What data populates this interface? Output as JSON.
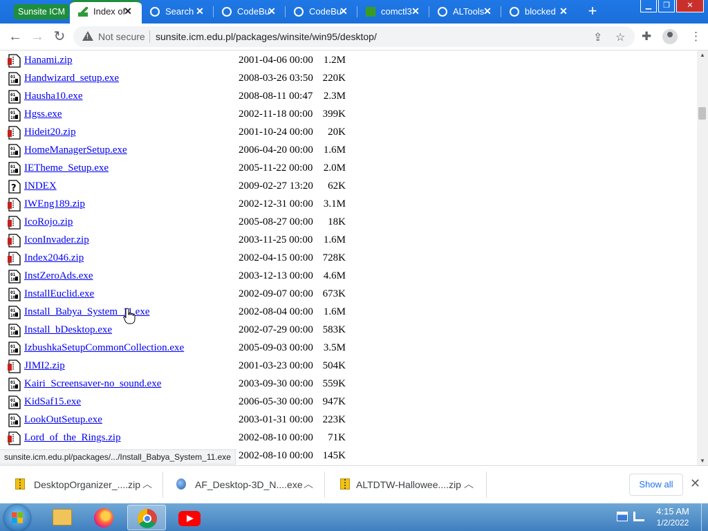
{
  "browser": {
    "tab_group_label": "Sunsite ICM",
    "tabs": [
      {
        "title": "Index of",
        "active": true
      },
      {
        "title": "Search"
      },
      {
        "title": "CodeBu"
      },
      {
        "title": "CodeBu"
      },
      {
        "title": "comctl3"
      },
      {
        "title": "ALTools"
      },
      {
        "title": "blocked"
      }
    ],
    "new_tab": "+",
    "security_label": "Not secure",
    "url": "sunsite.icm.edu.pl/packages/winsite/win95/desktop/"
  },
  "files": [
    {
      "name": "Hanami.zip",
      "date": "2001-04-06 00:00",
      "size": "1.2M",
      "icon": "zip-icon"
    },
    {
      "name": "Handwizard_setup.exe",
      "date": "2008-03-26 03:50",
      "size": "220K",
      "icon": "binary-icon"
    },
    {
      "name": "Hausha10.exe",
      "date": "2008-08-11 00:47",
      "size": "2.3M",
      "icon": "binary-icon"
    },
    {
      "name": "Hgss.exe",
      "date": "2002-11-18 00:00",
      "size": "399K",
      "icon": "binary-icon"
    },
    {
      "name": "Hideit20.zip",
      "date": "2001-10-24 00:00",
      "size": "20K",
      "icon": "zip-icon"
    },
    {
      "name": "HomeManagerSetup.exe",
      "date": "2006-04-20 00:00",
      "size": "1.6M",
      "icon": "binary-icon"
    },
    {
      "name": "IETheme_Setup.exe",
      "date": "2005-11-22 00:00",
      "size": "2.0M",
      "icon": "binary-icon"
    },
    {
      "name": "INDEX",
      "date": "2009-02-27 13:20",
      "size": "62K",
      "icon": "unknown-file-icon"
    },
    {
      "name": "IWEng189.zip",
      "date": "2002-12-31 00:00",
      "size": "3.1M",
      "icon": "zip-icon"
    },
    {
      "name": "IcoRojo.zip",
      "date": "2005-08-27 00:00",
      "size": "18K",
      "icon": "zip-icon"
    },
    {
      "name": "IconInvader.zip",
      "date": "2003-11-25 00:00",
      "size": "1.6M",
      "icon": "zip-icon"
    },
    {
      "name": "Index2046.zip",
      "date": "2002-04-15 00:00",
      "size": "728K",
      "icon": "zip-icon"
    },
    {
      "name": "InstZeroAds.exe",
      "date": "2003-12-13 00:00",
      "size": "4.6M",
      "icon": "binary-icon"
    },
    {
      "name": "InstallEuclid.exe",
      "date": "2002-09-07 00:00",
      "size": "673K",
      "icon": "binary-icon"
    },
    {
      "name": "Install_Babya_System_11.exe",
      "date": "2002-08-04 00:00",
      "size": "1.6M",
      "icon": "binary-icon"
    },
    {
      "name": "Install_bDesktop.exe",
      "date": "2002-07-29 00:00",
      "size": "583K",
      "icon": "binary-icon"
    },
    {
      "name": "IzbushkaSetupCommonCollection.exe",
      "date": "2005-09-03 00:00",
      "size": "3.5M",
      "icon": "binary-icon"
    },
    {
      "name": "JIMI2.zip",
      "date": "2001-03-23 00:00",
      "size": "504K",
      "icon": "zip-icon"
    },
    {
      "name": "Kairi_Screensaver-no_sound.exe",
      "date": "2003-09-30 00:00",
      "size": "559K",
      "icon": "binary-icon"
    },
    {
      "name": "KidSaf15.exe",
      "date": "2006-05-30 00:00",
      "size": "947K",
      "icon": "binary-icon"
    },
    {
      "name": "LookOutSetup.exe",
      "date": "2003-01-31 00:00",
      "size": "223K",
      "icon": "binary-icon"
    },
    {
      "name": "Lord_of_the_Rings.zip",
      "date": "2002-08-10 00:00",
      "size": "71K",
      "icon": "zip-icon"
    },
    {
      "name": "",
      "date": "2002-08-10 00:00",
      "size": "145K",
      "icon": "zip-icon"
    }
  ],
  "status_url": "sunsite.icm.edu.pl/packages/.../Install_Babya_System_11.exe",
  "downloads": [
    {
      "name": "DesktopOrganizer_....zip",
      "icon": "zip-icon"
    },
    {
      "name": "AF_Desktop-3D_N....exe",
      "icon": "exe-icon"
    },
    {
      "name": "ALTDTW-Hallowee....zip",
      "icon": "zip-icon"
    }
  ],
  "show_all": "Show all",
  "clock": {
    "time": "4:15 AM",
    "date": "1/2/2022"
  }
}
